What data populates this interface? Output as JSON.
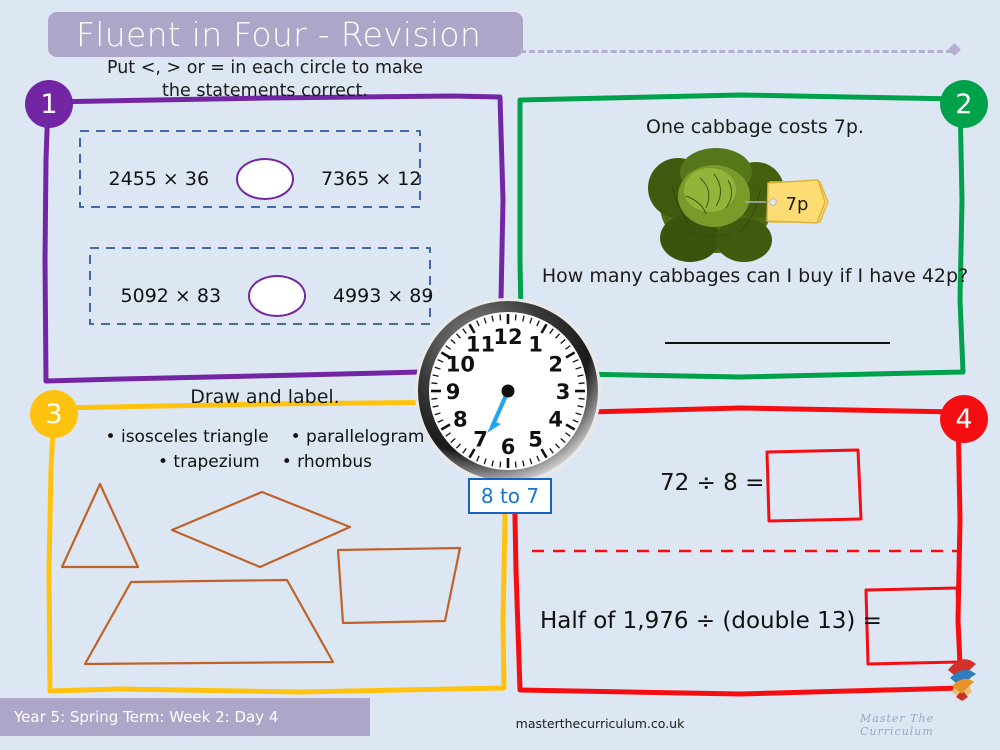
{
  "header": {
    "title": "Fluent in Four - Revision"
  },
  "colors": {
    "background": "#dde7f3",
    "title_bar": "#ada6c8",
    "q1_purple": "#7326a3",
    "q2_green": "#00a14b",
    "q3_yellow": "#ffc20e",
    "q4_red": "#f40e12",
    "shape_outline": "#c0622a",
    "clock_hand": "#23a5f0",
    "clock_label_text": "#1878d0"
  },
  "questions": [
    {
      "number": "1",
      "accent": "#7326a3",
      "instruction": "Put <, > or = in each circle to make the statements correct.",
      "rows": [
        {
          "left": "2455 × 36",
          "operator": "",
          "right": "7365 × 12"
        },
        {
          "left": "5092 × 83",
          "operator": "",
          "right": "4993 × 89"
        }
      ]
    },
    {
      "number": "2",
      "accent": "#00a14b",
      "statement": "One cabbage costs 7p.",
      "price_tag": "7p",
      "question": "How many cabbages can I buy if I have 42p?",
      "answer": ""
    },
    {
      "number": "3",
      "accent": "#ffc20e",
      "instruction": "Draw and label.",
      "shape_labels": [
        "• isosceles triangle",
        "• parallelogram",
        "• trapezium",
        "• rhombus"
      ],
      "drawn_shapes": [
        "triangle",
        "rhombus",
        "parallelogram",
        "trapezium"
      ]
    },
    {
      "number": "4",
      "accent": "#f40e12",
      "equations": [
        {
          "text": "72 ÷ 8 =",
          "answer": ""
        },
        {
          "text": "Half of 1,976 ÷ (double 13) =",
          "answer": ""
        }
      ]
    }
  ],
  "clock": {
    "label": "8 to 7",
    "numerals": [
      "12",
      "1",
      "2",
      "3",
      "4",
      "5",
      "6",
      "7",
      "8",
      "9",
      "10",
      "11"
    ],
    "hand_points_to": "7"
  },
  "footer": {
    "term_label": "Year 5: Spring Term: Week 2: Day 4",
    "url": "masterthecurriculum.co.uk",
    "brand": "Master The Curriculum"
  }
}
